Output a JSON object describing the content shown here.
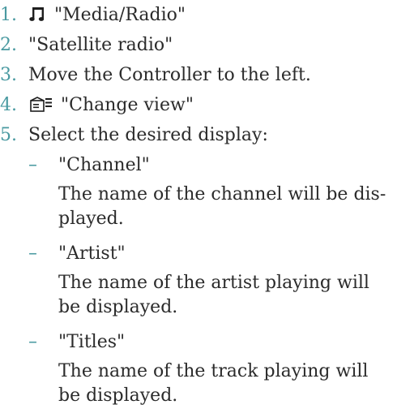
{
  "steps": [
    {
      "num": "1.",
      "icon": "music-note-icon",
      "text": "\"Media/Radio\""
    },
    {
      "num": "2.",
      "text": "\"Satellite radio\""
    },
    {
      "num": "3.",
      "text": "Move the Controller to the left."
    },
    {
      "num": "4.",
      "icon": "change-view-icon",
      "text": "\"Change view\""
    },
    {
      "num": "5.",
      "text": "Select the desired display:"
    }
  ],
  "options": [
    {
      "label": "\"Channel\"",
      "desc": "The name of the channel will be dis-played."
    },
    {
      "label": "\"Artist\"",
      "desc": "The name of the artist playing will be displayed."
    },
    {
      "label": "\"Titles\"",
      "desc": "The name of the track playing will be displayed."
    }
  ],
  "colors": {
    "accent": "#4a9aa1",
    "text": "#2b2b2b"
  }
}
